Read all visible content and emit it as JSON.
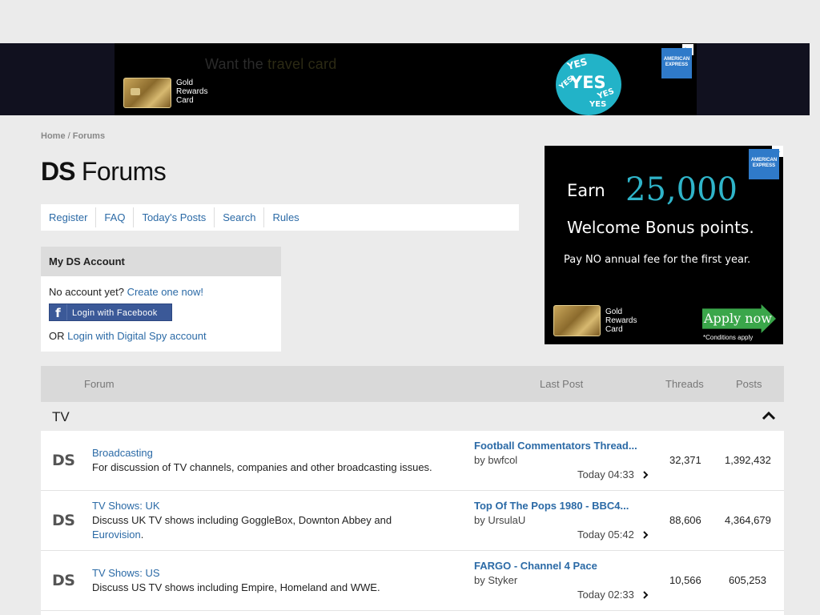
{
  "top_ad": {
    "headline_a": "Want the ",
    "headline_b": "travel card",
    "card_label": [
      "Gold",
      "Rewards",
      "Card"
    ],
    "yes_words": [
      "YES",
      "YES",
      "YES",
      "YES",
      "YES"
    ],
    "amex": [
      "AMERICAN",
      "EXPRESS"
    ]
  },
  "breadcrumb": {
    "home": "Home",
    "sep": " / ",
    "current": "Forums"
  },
  "title": {
    "brand": "DS",
    "text": " Forums"
  },
  "nav": {
    "items": [
      "Register",
      "FAQ",
      "Today's Posts",
      "Search",
      "Rules"
    ]
  },
  "account": {
    "heading": "My DS Account",
    "no_account": "No account yet? ",
    "create_link": "Create one now!",
    "facebook_label": "Login with Facebook",
    "or_text": "OR ",
    "ds_login_link": "Login with Digital Spy account"
  },
  "side_ad": {
    "earn": "Earn",
    "points_number": "25,000",
    "welcome": "Welcome Bonus points.",
    "fee": "Pay NO annual fee for the first year.",
    "card_label": [
      "Gold",
      "Rewards",
      "Card"
    ],
    "apply": "Apply now",
    "conditions": "*Conditions apply",
    "amex": [
      "AMERICAN",
      "EXPRESS"
    ]
  },
  "forum_table": {
    "headers": {
      "forum": "Forum",
      "last_post": "Last Post",
      "threads": "Threads",
      "posts": "Posts"
    },
    "section": "TV",
    "rows": [
      {
        "logo": "DS",
        "title": "Broadcasting",
        "desc": "For discussion of TV channels, companies and other broadcasting issues.",
        "desc_link": "",
        "last_title": "Football Commentators Thread...",
        "last_by_prefix": "by ",
        "last_by": "bwfcol",
        "last_time": "Today 04:33",
        "threads": "32,371",
        "posts": "1,392,432"
      },
      {
        "logo": "DS",
        "title": "TV Shows: UK",
        "desc": "Discuss UK TV shows including GoggleBox, Downton Abbey and",
        "desc_link": "Eurovision",
        "desc_end": ".",
        "last_title": "Top Of The Pops 1980 - BBC4...",
        "last_by_prefix": "by ",
        "last_by": "UrsulaU",
        "last_time": "Today 05:42",
        "threads": "88,606",
        "posts": "4,364,679"
      },
      {
        "logo": "DS",
        "title": "TV Shows: US",
        "desc": "Discuss US TV shows including Empire, Homeland and WWE.",
        "desc_link": "",
        "last_title": "FARGO - Channel 4 Pace",
        "last_by_prefix": "by ",
        "last_by": "Styker",
        "last_time": "Today 02:33",
        "threads": "10,566",
        "posts": "605,253"
      }
    ]
  }
}
